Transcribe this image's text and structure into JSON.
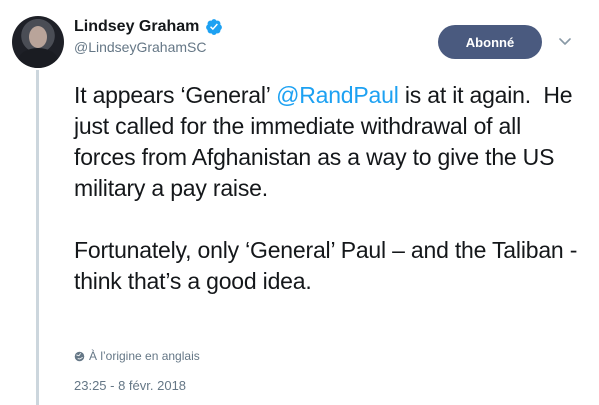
{
  "author": {
    "name": "Lindsey Graham",
    "handle": "@LindseyGrahamSC",
    "verified_icon": "verified-badge-icon",
    "avatar_icon": "profile-photo"
  },
  "follow_button": {
    "label": "Abonné"
  },
  "menu_icon": "chevron-down-icon",
  "tweet": {
    "line1_before": "It appears ‘General’ ",
    "mention": "@RandPaul",
    "line1_after": " is at it again.  He just called for the immediate withdrawal of all forces from Afghanistan as a way to give the US military a pay raise.\n\nFortunately, only ‘General’ Paul – and the Taliban - think that’s a good idea."
  },
  "translation_note": "À l’origine en anglais",
  "timestamp": "23:25 - 8 févr. 2018",
  "colors": {
    "accent": "#1da1f2",
    "follow_button_bg": "#4a5a7f",
    "muted_text": "#657786",
    "thread_line": "#ccd6dd"
  }
}
